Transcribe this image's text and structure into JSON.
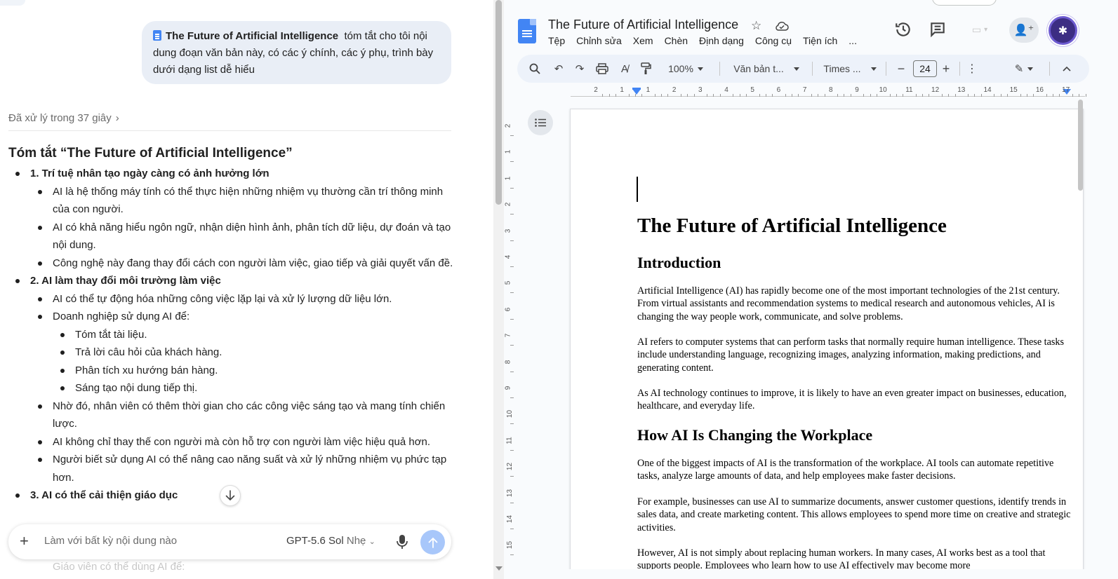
{
  "chat": {
    "user_message": {
      "doc_chip": "The Future of Artificial Intelligence",
      "text": "tóm tắt cho tôi nội dung đoạn văn bản này, có các ý chính, các ý phụ, trình bày dưới dạng list dễ hiểu"
    },
    "thinking_label": "Đã xử lý trong 37 giây",
    "summary_title": "Tóm tắt “The Future of Artificial Intelligence”",
    "items": [
      {
        "level": 1,
        "text": "1. Trí tuệ nhân tạo ngày càng có ảnh hưởng lớn"
      },
      {
        "level": 2,
        "text": "AI là hệ thống máy tính có thể thực hiện những nhiệm vụ thường cần trí thông minh của con người."
      },
      {
        "level": 2,
        "text": "AI có khả năng hiểu ngôn ngữ, nhận diện hình ảnh, phân tích dữ liệu, dự đoán và tạo nội dung."
      },
      {
        "level": 2,
        "text": "Công nghệ này đang thay đổi cách con người làm việc, giao tiếp và giải quyết vấn đề."
      },
      {
        "level": 1,
        "text": "2. AI làm thay đổi môi trường làm việc"
      },
      {
        "level": 2,
        "text": "AI có thể tự động hóa những công việc lặp lại và xử lý lượng dữ liệu lớn."
      },
      {
        "level": 2,
        "text": "Doanh nghiệp sử dụng AI để:"
      },
      {
        "level": 3,
        "text": "Tóm tắt tài liệu."
      },
      {
        "level": 3,
        "text": "Trả lời câu hỏi của khách hàng."
      },
      {
        "level": 3,
        "text": "Phân tích xu hướng bán hàng."
      },
      {
        "level": 3,
        "text": "Sáng tạo nội dung tiếp thị."
      },
      {
        "level": 2,
        "text": "Nhờ đó, nhân viên có thêm thời gian cho các công việc sáng tạo và mang tính chiến lược."
      },
      {
        "level": 2,
        "text": "AI không chỉ thay thế con người mà còn hỗ trợ con người làm việc hiệu quả hơn."
      },
      {
        "level": 2,
        "text": "Người biết sử dụng AI có thể nâng cao năng suất và xử lý những nhiệm vụ phức tạp hơn."
      },
      {
        "level": 1,
        "text": "3. AI có thể cải thiện giáo dục"
      }
    ],
    "below_text": "Giáo viên có thể dùng AI để:",
    "composer": {
      "placeholder": "Làm với bất kỳ nội dung nào",
      "model": "GPT-5.6 Sol",
      "effort": "Nhẹ"
    }
  },
  "docs": {
    "title": "The Future of Artificial Intelligence",
    "menu": [
      "Tệp",
      "Chỉnh sửa",
      "Xem",
      "Chèn",
      "Định dạng",
      "Công cụ",
      "Tiện ích",
      "..."
    ],
    "toolbar": {
      "zoom": "100%",
      "style": "Văn bản t...",
      "font": "Times ...",
      "font_size": "24"
    },
    "ruler_labels": [
      "2",
      "1",
      "1",
      "2",
      "3",
      "4",
      "5",
      "6",
      "7",
      "8",
      "9",
      "10",
      "11",
      "12",
      "13",
      "14",
      "15",
      "16",
      "17"
    ],
    "vruler_labels": [
      "2",
      "1",
      "1",
      "2",
      "3",
      "4",
      "5",
      "6",
      "7",
      "8",
      "9",
      "10",
      "11",
      "12",
      "13",
      "14",
      "15"
    ],
    "content": {
      "title": "The Future of Artificial Intelligence",
      "h_intro": "Introduction",
      "p1": "Artificial Intelligence (AI) has rapidly become one of the most important technologies of the 21st century. From virtual assistants and recommendation systems to medical research and autonomous vehicles, AI is changing the way people work, communicate, and solve problems.",
      "p2": "AI refers to computer systems that can perform tasks that normally require human intelligence. These tasks include understanding language, recognizing images, analyzing information, making predictions, and generating content.",
      "p3": "As AI technology continues to improve, it is likely to have an even greater impact on businesses, education, healthcare, and everyday life.",
      "h_work": "How AI Is Changing the Workplace",
      "p4": "One of the biggest impacts of AI is the transformation of the workplace. AI tools can automate repetitive tasks, analyze large amounts of data, and help employees make faster decisions.",
      "p5": "For example, businesses can use AI to summarize documents, answer customer questions, identify trends in sales data, and create marketing content. This allows employees to spend more time on creative and strategic activities.",
      "p6": "However, AI is not simply about replacing human workers. In many cases, AI works best as a tool that supports people. Employees who learn how to use AI effectively may become more"
    }
  }
}
